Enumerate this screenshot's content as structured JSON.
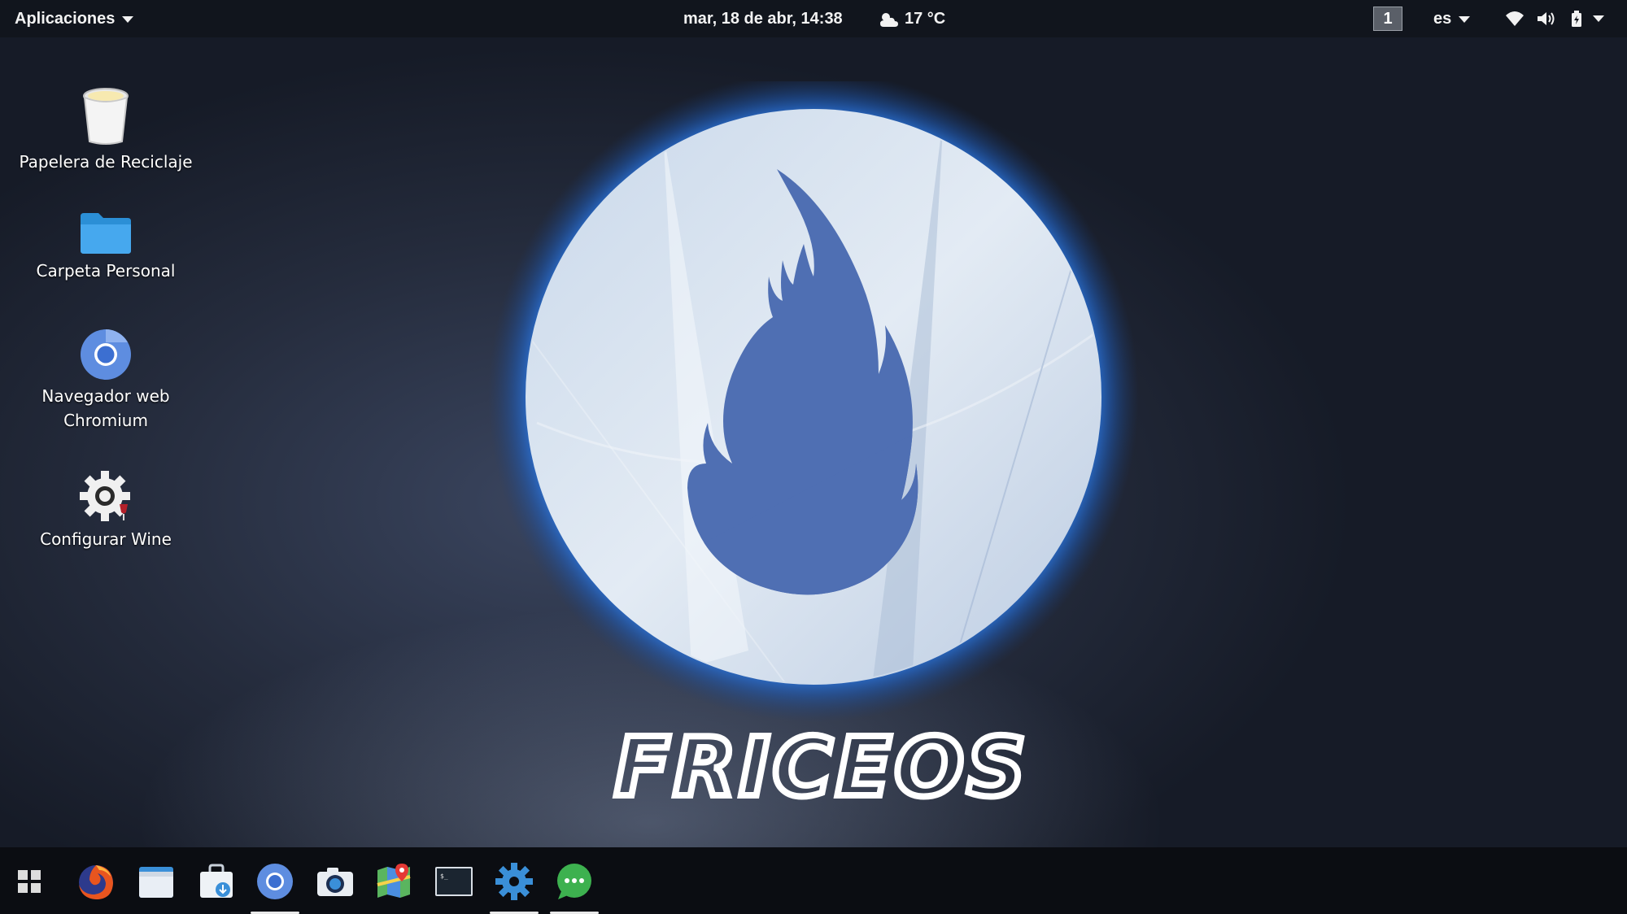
{
  "topbar": {
    "apps_menu_label": "Aplicaciones",
    "clock": "mar, 18 de abr, 14:38",
    "weather_temp": "17 °C",
    "weather_icon": "cloudy-sun-icon",
    "workspace_number": "1",
    "keyboard_layout": "es",
    "tray_icons": [
      "wifi-icon",
      "volume-icon",
      "battery-icon",
      "system-menu-caret-icon"
    ]
  },
  "desktop": {
    "icons": [
      {
        "label": "Papelera de Reciclaje",
        "icon": "trash-icon"
      },
      {
        "label": "Carpeta Personal",
        "icon": "folder-icon"
      },
      {
        "label": "Navegador web Chromium",
        "icon": "chromium-icon"
      },
      {
        "label": "Configurar Wine",
        "icon": "wine-config-icon"
      }
    ]
  },
  "wallpaper": {
    "brand_text": "FRICEOS",
    "colors": {
      "flame": "#4f6fb3",
      "flame_light": "#8aa0cc",
      "glow": "#2b6fd6",
      "circle": "#d7e2ef"
    }
  },
  "dock": {
    "items": [
      {
        "icon": "app-grid-icon",
        "running": false
      },
      {
        "icon": "firefox-icon",
        "running": false
      },
      {
        "icon": "file-manager-icon",
        "running": false
      },
      {
        "icon": "software-center-icon",
        "running": false
      },
      {
        "icon": "chromium-icon",
        "running": true
      },
      {
        "icon": "camera-icon",
        "running": false
      },
      {
        "icon": "maps-icon",
        "running": false
      },
      {
        "icon": "terminal-icon",
        "running": false
      },
      {
        "icon": "settings-icon",
        "running": true
      },
      {
        "icon": "chat-icon",
        "running": true
      }
    ]
  }
}
